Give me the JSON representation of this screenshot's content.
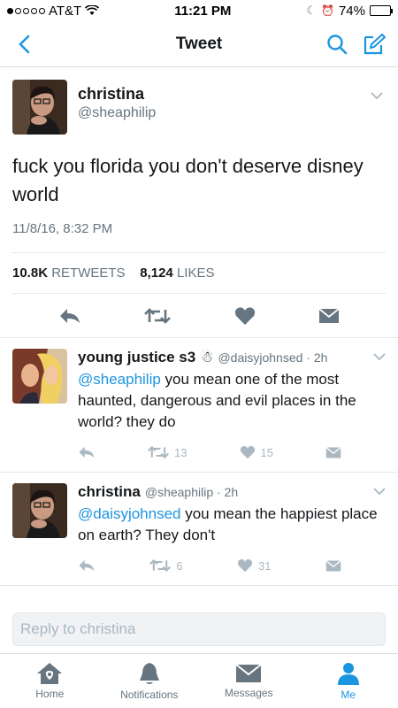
{
  "status_bar": {
    "carrier": "AT&T",
    "time": "11:21 PM",
    "battery": "74%",
    "battery_level": 0.74
  },
  "nav": {
    "title": "Tweet"
  },
  "tweet": {
    "name": "christina",
    "handle": "@sheaphilip",
    "text": "fuck you florida you don't deserve disney world",
    "timestamp": "11/8/16, 8:32 PM",
    "retweets_count": "10.8K",
    "retweets_label": "RETWEETS",
    "likes_count": "8,124",
    "likes_label": "LIKES"
  },
  "replies": [
    {
      "name": "young justice s3",
      "emoji": "☃",
      "meta": "@daisyjohnsed · 2h",
      "mention": "@sheaphilip",
      "text": " you mean one of the most haunted, dangerous and evil places in the world? they do",
      "retweets": "13",
      "likes": "15"
    },
    {
      "name": "christina",
      "meta": "@sheaphilip · 2h",
      "mention": "@daisyjohnsed",
      "text": " you mean the happiest place on earth? They don't",
      "retweets": "6",
      "likes": "31"
    }
  ],
  "reply_box": {
    "placeholder": "Reply to christina"
  },
  "tabs": [
    {
      "label": "Home",
      "icon": "home-icon"
    },
    {
      "label": "Notifications",
      "icon": "bell-icon"
    },
    {
      "label": "Messages",
      "icon": "envelope-icon"
    },
    {
      "label": "Me",
      "icon": "person-icon"
    }
  ],
  "colors": {
    "accent": "#1b95e0",
    "muted": "#66757f",
    "icon": "#aab8c2"
  }
}
